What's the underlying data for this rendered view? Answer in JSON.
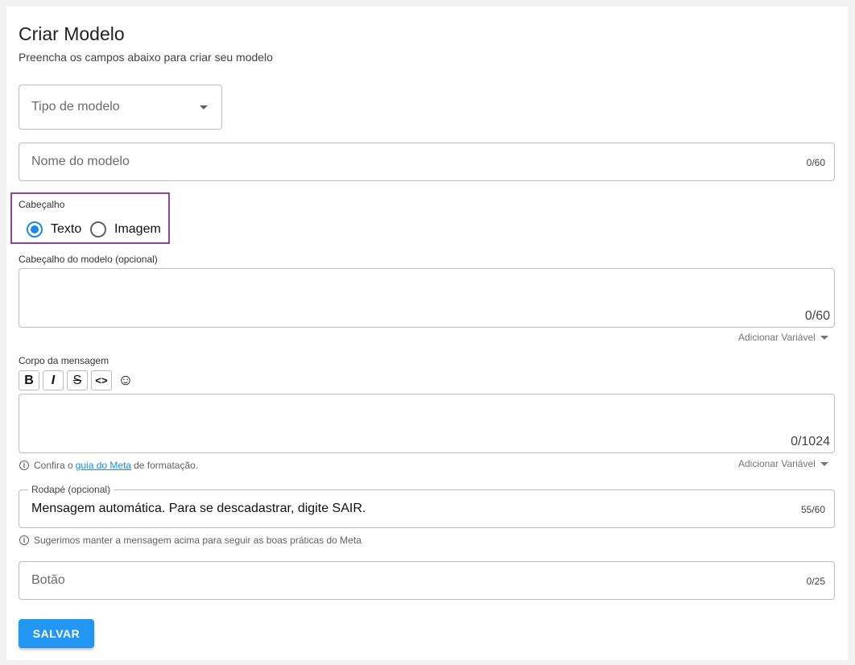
{
  "page": {
    "title": "Criar Modelo",
    "subtitle": "Preencha os campos abaixo para criar seu modelo"
  },
  "tipo_modelo": {
    "placeholder": "Tipo de modelo"
  },
  "nome_modelo": {
    "placeholder": "Nome do modelo",
    "counter": "0/60"
  },
  "cabecalho": {
    "label": "Cabeçalho",
    "options": [
      {
        "label": "Texto",
        "selected": true
      },
      {
        "label": "Imagem",
        "selected": false
      }
    ]
  },
  "cabecalho_modelo": {
    "label": "Cabeçalho do modelo (opcional)",
    "counter": "0/60",
    "add_variable": "Adicionar Variável"
  },
  "corpo": {
    "label": "Corpo da mensagem",
    "toolbar": {
      "bold": "B",
      "italic": "I",
      "strike": "S",
      "code": "<>",
      "emoji": "☺"
    },
    "counter": "0/1024",
    "hint_prefix": "Confira o",
    "hint_link": "guia do Meta",
    "hint_suffix": "de formatação.",
    "add_variable": "Adicionar Variável"
  },
  "rodape": {
    "label": "Rodapé (opcional)",
    "value": "Mensagem automática. Para se descadastrar, digite SAIR.",
    "counter": "55/60",
    "hint": "Sugerimos manter a mensagem acima para seguir as boas práticas do Meta"
  },
  "botao": {
    "placeholder": "Botão",
    "counter": "0/25"
  },
  "actions": {
    "save": "SALVAR"
  },
  "colors": {
    "accent": "#2196f3",
    "highlight": "#8e44a0"
  }
}
